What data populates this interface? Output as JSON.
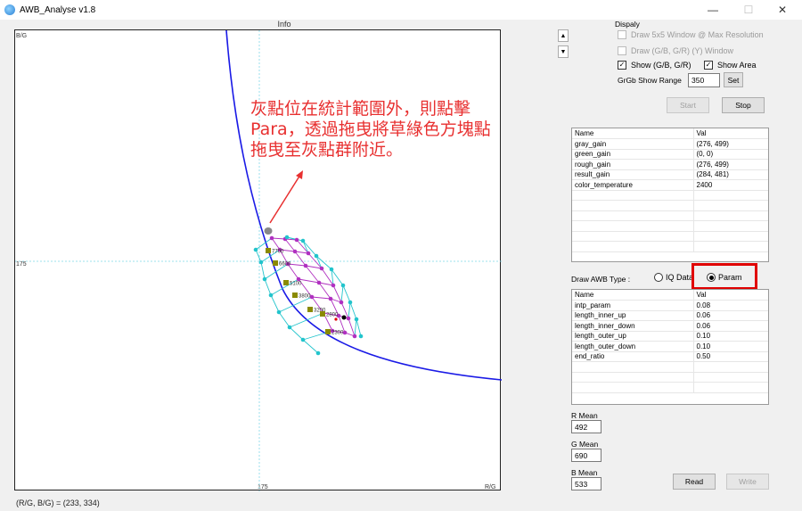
{
  "window": {
    "title": "AWB_Analyse v1.8",
    "min": "—",
    "max": "☐",
    "close": "✕"
  },
  "plot": {
    "title": "Info",
    "y_axis_label": "B/G",
    "x_axis_label": "R/G",
    "x_mid_label": "175",
    "y_mid_label": "175",
    "coord_readout": "(R/G, B/G) = (233, 334)",
    "point_labels": [
      "7700",
      "6600",
      "5100",
      "3800",
      "3200",
      "2800",
      "2300"
    ]
  },
  "annotation": {
    "text": "灰點位在統計範圍外，則點擊Para，透過拖曳將草綠色方塊點拖曳至灰點群附近。"
  },
  "display": {
    "group_label": "Dispaly",
    "draw_5x5": "Draw 5x5 Window @ Max Resolution",
    "draw_gbgr": "Draw (G/B, G/R) (Y) Window",
    "show_gbgr": "Show (G/B, G/R)",
    "show_area": "Show Area",
    "grgb_label": "GrGb Show Range",
    "grgb_value": "350",
    "set_label": "Set",
    "start_label": "Start",
    "stop_label": "Stop"
  },
  "info_table": {
    "headers": [
      "Name",
      "Val"
    ],
    "rows": [
      [
        "gray_gain",
        "(276, 499)"
      ],
      [
        "green_gain",
        "(0, 0)"
      ],
      [
        "rough_gain",
        "(276, 499)"
      ],
      [
        "result_gain",
        "(284, 481)"
      ],
      [
        "color_temperature",
        "2400"
      ]
    ]
  },
  "draw_type": {
    "label": "Draw AWB Type :",
    "option_iq": "IQ Data",
    "option_param": "Param",
    "selected": "Param"
  },
  "param_table": {
    "headers": [
      "Name",
      "Val"
    ],
    "rows": [
      [
        "intp_param",
        "0.08"
      ],
      [
        "length_inner_up",
        "0.06"
      ],
      [
        "length_inner_down",
        "0.06"
      ],
      [
        "length_outer_up",
        "0.10"
      ],
      [
        "length_outer_down",
        "0.10"
      ],
      [
        "end_ratio",
        "0.50"
      ]
    ]
  },
  "means": {
    "r_label": "R Mean",
    "r_value": "492",
    "g_label": "G Mean",
    "g_value": "690",
    "b_label": "B Mean",
    "b_value": "533"
  },
  "actions": {
    "read_label": "Read",
    "write_label": "Write"
  },
  "colors": {
    "curve": "#1a1ae6",
    "outer": "#22c4cc",
    "inner": "#b030c0",
    "square": "#8a8a00",
    "annotation": "#e83030",
    "highlight": "#e00000"
  }
}
